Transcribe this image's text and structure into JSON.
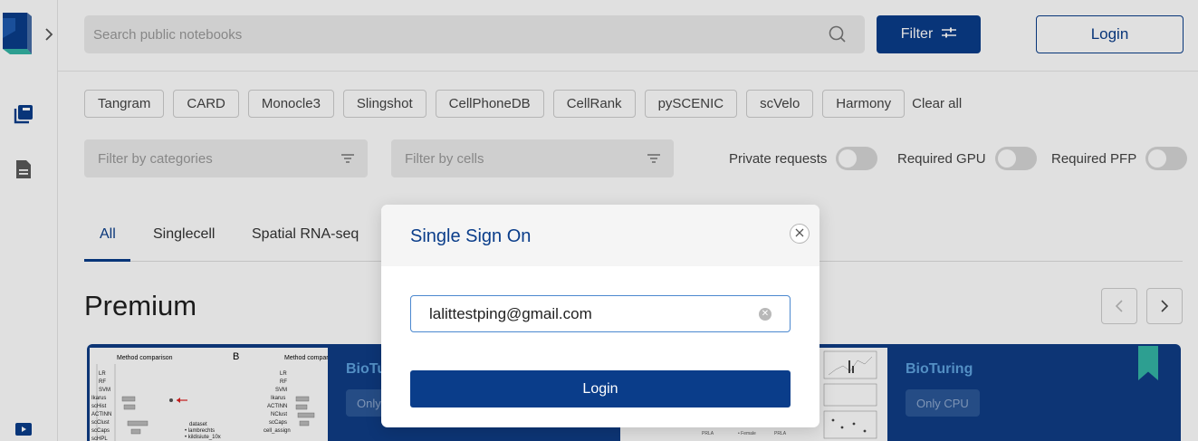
{
  "header": {
    "search_placeholder": "Search public notebooks",
    "filter_label": "Filter",
    "login_label": "Login"
  },
  "tags": [
    "Tangram",
    "CARD",
    "Monocle3",
    "Slingshot",
    "CellPhoneDB",
    "CellRank",
    "pySCENIC",
    "scVelo",
    "Harmony"
  ],
  "clear_all": "Clear all",
  "filters": {
    "categories_placeholder": "Filter by categories",
    "cells_placeholder": "Filter by cells",
    "private_requests": "Private requests",
    "required_gpu": "Required GPU",
    "required_pfp": "Required PFP"
  },
  "tabs": [
    "All",
    "Singlecell",
    "Spatial RNA-seq"
  ],
  "premium": {
    "title": "Premium",
    "cards": [
      {
        "title": "BioTu",
        "badge": "Only"
      },
      {
        "title": "BioTuring",
        "badge": "Only CPU"
      }
    ]
  },
  "modal": {
    "title": "Single Sign On",
    "email_value": "lalittestping@gmail.com",
    "login_label": "Login"
  },
  "colors": {
    "brand": "#0a3d8a",
    "card_bg": "#0f3d86",
    "bookmark": "#34b5a5"
  }
}
